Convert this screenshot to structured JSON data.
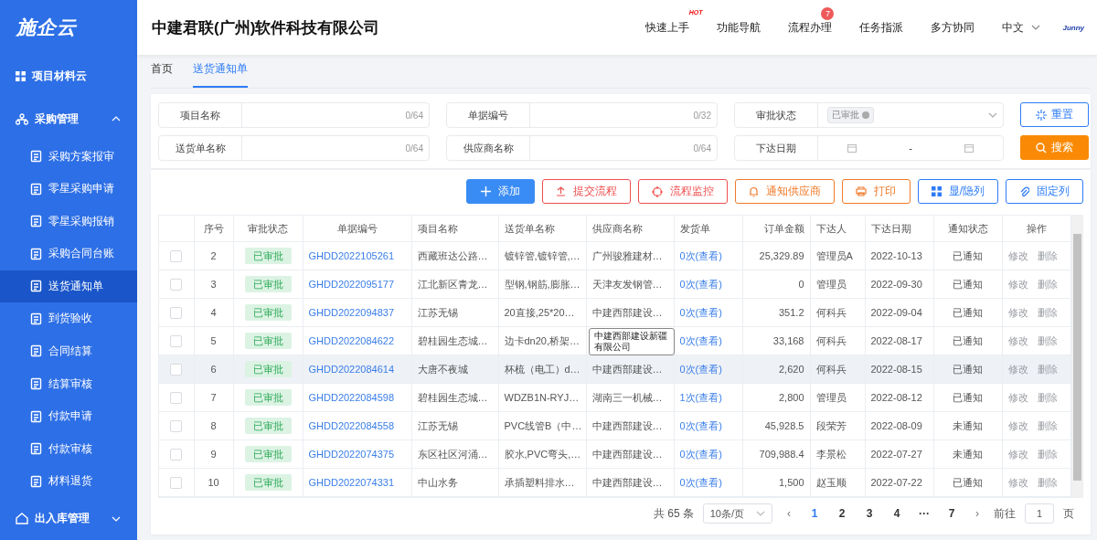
{
  "sidebar": {
    "logo": "施企云",
    "items": [
      {
        "label": "项目材料云",
        "kind": "link"
      },
      {
        "label": "采购管理",
        "kind": "group",
        "expanded": true,
        "children": [
          {
            "label": "采购方案报审",
            "selected": false
          },
          {
            "label": "零星采购申请",
            "selected": false
          },
          {
            "label": "零星采购报销",
            "selected": false
          },
          {
            "label": "采购合同台账",
            "selected": false
          },
          {
            "label": "送货通知单",
            "selected": true
          },
          {
            "label": "到货验收",
            "selected": false
          },
          {
            "label": "合同结算",
            "selected": false
          },
          {
            "label": "结算审核",
            "selected": false
          },
          {
            "label": "付款申请",
            "selected": false
          },
          {
            "label": "付款审核",
            "selected": false
          },
          {
            "label": "材料退货",
            "selected": false
          }
        ]
      },
      {
        "label": "出入库管理",
        "kind": "group",
        "expanded": false
      }
    ]
  },
  "header": {
    "title": "中建君联(广州)软件科技有限公司",
    "nav": [
      {
        "label": "快速上手",
        "badge": {
          "kind": "hot",
          "text": "HOT"
        }
      },
      {
        "label": "功能导航"
      },
      {
        "label": "流程办理",
        "badge": {
          "kind": "count",
          "text": "7"
        }
      },
      {
        "label": "任务指派"
      },
      {
        "label": "多方协同"
      }
    ],
    "language": "中文",
    "brand": "Junny"
  },
  "tabs": [
    {
      "label": "首页",
      "selected": false
    },
    {
      "label": "送货通知单",
      "selected": true
    }
  ],
  "filters": {
    "fields": [
      {
        "kind": "text",
        "label": "项目名称",
        "counter": "0/64"
      },
      {
        "kind": "text",
        "label": "单据编号",
        "counter": "0/32"
      },
      {
        "kind": "select",
        "label": "审批状态",
        "tags": [
          "已审批"
        ]
      },
      {
        "kind": "text",
        "label": "送货单名称",
        "counter": "0/64"
      },
      {
        "kind": "text",
        "label": "供应商名称",
        "counter": "0/64"
      },
      {
        "kind": "daterange",
        "label": "下达日期",
        "separator": "-"
      }
    ],
    "buttons": [
      {
        "label": "重置",
        "kind": "outline"
      },
      {
        "label": "搜索",
        "kind": "solid"
      }
    ]
  },
  "toolbar": [
    {
      "label": "添加",
      "kind": "solid",
      "color": "#3a8cf5"
    },
    {
      "label": "提交流程",
      "kind": "outline",
      "color": "#ef5050"
    },
    {
      "label": "流程监控",
      "kind": "outline",
      "color": "#ef5050"
    },
    {
      "label": "通知供应商",
      "kind": "outline",
      "color": "#f07b2a"
    },
    {
      "label": "打印",
      "kind": "outline",
      "color": "#f07b2a"
    },
    {
      "label": "显/隐列",
      "kind": "outline",
      "color": "#2d7cf6"
    },
    {
      "label": "固定列",
      "kind": "outline",
      "color": "#2d7cf6"
    }
  ],
  "table": {
    "columns": [
      "序号",
      "审批状态",
      "单据编号",
      "项目名称",
      "送货单名称",
      "供应商名称",
      "发货单",
      "订单金额",
      "下达人",
      "下达日期",
      "通知状态",
      "操作"
    ],
    "rows": [
      {
        "checked": false,
        "hovered": false,
        "no": "2",
        "status": "已审批",
        "code": "GHDD2022105261",
        "project": "西藏班达公路…",
        "delivery": "镀锌管,镀锌管,…",
        "supplier": "广州骏雅建材…",
        "shipment": "0次(查看)",
        "amount": "25,329.89",
        "issuer": "管理员A",
        "date": "2022-10-13",
        "notice": "已通知",
        "actions": [
          {
            "label": "修改",
            "disabled": true
          },
          {
            "label": "删除",
            "disabled": true
          }
        ]
      },
      {
        "checked": false,
        "hovered": false,
        "no": "3",
        "status": "已审批",
        "code": "GHDD2022095177",
        "project": "江北新区青龙…",
        "delivery": "型钢,钢筋,膨胀…",
        "supplier": "天津友发钢管…",
        "shipment": "0次(查看)",
        "amount": "0",
        "issuer": "管理员",
        "date": "2022-09-30",
        "notice": "已通知",
        "actions": [
          {
            "label": "修改",
            "disabled": true
          },
          {
            "label": "删除",
            "disabled": true
          }
        ]
      },
      {
        "checked": false,
        "hovered": false,
        "no": "4",
        "status": "已审批",
        "code": "GHDD2022094837",
        "project": "江苏无锡",
        "delivery": "20直接,25*20…",
        "supplier": "中建西部建设…",
        "shipment": "0次(查看)",
        "amount": "351.2",
        "issuer": "何科兵",
        "date": "2022-09-04",
        "notice": "已通知",
        "actions": [
          {
            "label": "修改",
            "disabled": true
          },
          {
            "label": "删除",
            "disabled": true
          }
        ]
      },
      {
        "checked": false,
        "hovered": false,
        "no": "5",
        "status": "已审批",
        "code": "GHDD2022084622",
        "project": "碧桂园生态城…",
        "delivery": "边卡dn20,桥架…",
        "tooltip": "中建西部建设新疆有限公司",
        "shipment": "0次(查看)",
        "amount": "33,168",
        "issuer": "何科兵",
        "date": "2022-08-17",
        "notice": "已通知",
        "actions": [
          {
            "label": "修改",
            "disabled": true
          },
          {
            "label": "删除",
            "disabled": true
          }
        ]
      },
      {
        "checked": false,
        "hovered": true,
        "no": "6",
        "status": "已审批",
        "code": "GHDD2022084614",
        "project": "大唐不夜城",
        "delivery": "杯梳（电工）d…",
        "supplier": "中建西部建设…",
        "shipment": "0次(查看)",
        "amount": "2,620",
        "issuer": "何科兵",
        "date": "2022-08-15",
        "notice": "已通知",
        "actions": [
          {
            "label": "修改",
            "disabled": true
          },
          {
            "label": "删除",
            "disabled": true
          }
        ]
      },
      {
        "checked": false,
        "hovered": false,
        "no": "7",
        "status": "已审批",
        "code": "GHDD2022084598",
        "project": "碧桂园生态城…",
        "delivery": "WDZB1N-RYJ…",
        "supplier": "湖南三一机械…",
        "shipment": "1次(查看)",
        "amount": "2,800",
        "issuer": "管理员",
        "date": "2022-08-12",
        "notice": "已通知",
        "actions": [
          {
            "label": "修改",
            "disabled": true
          },
          {
            "label": "删除",
            "disabled": true
          }
        ]
      },
      {
        "checked": false,
        "hovered": false,
        "no": "8",
        "status": "已审批",
        "code": "GHDD2022084558",
        "project": "江苏无锡",
        "delivery": "PVC线管B（中…",
        "supplier": "中建西部建设…",
        "shipment": "0次(查看)",
        "amount": "45,928.5",
        "issuer": "段荣芳",
        "date": "2022-08-09",
        "notice": "未通知",
        "actions": [
          {
            "label": "修改",
            "disabled": true
          },
          {
            "label": "删除",
            "disabled": true
          }
        ]
      },
      {
        "checked": false,
        "hovered": false,
        "no": "9",
        "status": "已审批",
        "code": "GHDD2022074375",
        "project": "东区社区河涌…",
        "delivery": "胶水,PVC弯头,…",
        "supplier": "中建西部建设…",
        "shipment": "0次(查看)",
        "amount": "709,988.4",
        "issuer": "李景松",
        "date": "2022-07-27",
        "notice": "未通知",
        "actions": [
          {
            "label": "修改",
            "disabled": true
          },
          {
            "label": "删除",
            "disabled": true
          }
        ]
      },
      {
        "checked": false,
        "hovered": false,
        "no": "10",
        "status": "已审批",
        "code": "GHDD2022074331",
        "project": "中山水务",
        "delivery": "承插塑料排水…",
        "supplier": "中建西部建设…",
        "shipment": "0次(查看)",
        "amount": "1,500",
        "issuer": "赵玉顺",
        "date": "2022-07-22",
        "notice": "已通知",
        "actions": [
          {
            "label": "修改",
            "disabled": true
          },
          {
            "label": "删除",
            "disabled": true
          }
        ]
      }
    ]
  },
  "pagination": {
    "total": "共 65 条",
    "page_size": "10条/页",
    "prev": "‹",
    "next": "›",
    "pages": [
      {
        "label": "1",
        "selected": true
      },
      {
        "label": "2",
        "selected": false
      },
      {
        "label": "3",
        "selected": false
      },
      {
        "label": "4",
        "selected": false
      },
      {
        "label": "···",
        "selected": false
      },
      {
        "label": "7",
        "selected": false
      }
    ],
    "goto_label": "前往",
    "goto_value": "1",
    "goto_suffix": "页"
  }
}
